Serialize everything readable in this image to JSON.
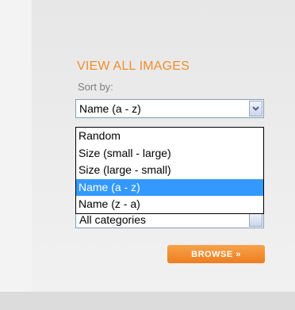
{
  "panel": {
    "title": "VIEW ALL IMAGES",
    "sort_label": "Sort by:"
  },
  "sort_select": {
    "value": "Name (a - z)",
    "options": [
      "Random",
      "Size (small - large)",
      "Size (large - small)",
      "Name (a - z)",
      "Name (z - a)"
    ],
    "selected_index": 3,
    "arrow_icon": "chevron-down-icon"
  },
  "category_select": {
    "value": "All categories"
  },
  "browse_button": {
    "label": "BROWSE »"
  },
  "colors": {
    "title": "#ef8e2e",
    "button": "#ee7d1f",
    "highlight": "#3399ff"
  }
}
